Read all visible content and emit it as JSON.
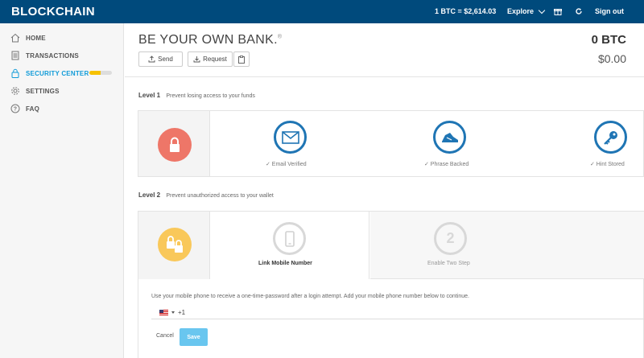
{
  "header": {
    "logo": "BLOCKCHAIN",
    "price": "1 BTC =  $2,614.03",
    "explore": "Explore",
    "signout": "Sign out"
  },
  "sidebar": {
    "items": [
      {
        "label": "HOME",
        "icon": "home-icon"
      },
      {
        "label": "TRANSACTIONS",
        "icon": "transactions-icon"
      },
      {
        "label": "SECURITY CENTER",
        "icon": "lock-icon"
      },
      {
        "label": "SETTINGS",
        "icon": "gear-icon"
      },
      {
        "label": "FAQ",
        "icon": "help-icon"
      }
    ],
    "security_progress": 0.5,
    "active_color": "#109bd8"
  },
  "main": {
    "title": "BE YOUR OWN BANK.",
    "title_mark": "®",
    "send_label": "Send",
    "request_label": "Request",
    "balance_btc": "0 BTC",
    "balance_usd": "$0.00"
  },
  "level1": {
    "title": "Level 1",
    "subtitle": "Prevent losing access to your funds",
    "steps": [
      {
        "label": "✓  Email Verified",
        "icon": "envelope-icon"
      },
      {
        "label": "✓  Phrase Backed",
        "icon": "recovery-phrase-icon"
      },
      {
        "label": "✓  Hint Stored",
        "icon": "key-icon"
      }
    ]
  },
  "level2": {
    "title": "Level 2",
    "subtitle": "Prevent unauthorized access to your wallet",
    "tabs": [
      {
        "label": "Link Mobile Number",
        "icon": "mobile-phone-icon"
      },
      {
        "label": "Enable Two Step",
        "number": "2"
      }
    ],
    "help": "Use your mobile phone to receive a one-time-password after a login attempt. Add your mobile phone number below to continue.",
    "phone_prefix": "+1",
    "cancel_label": "Cancel",
    "save_label": "Save"
  },
  "colors": {
    "header_bg": "#004a7c",
    "level1_lock": "#ee7668",
    "level2_lock": "#f9c85a",
    "step_blue": "#1f75b4",
    "save_bg": "#69c6ef"
  }
}
